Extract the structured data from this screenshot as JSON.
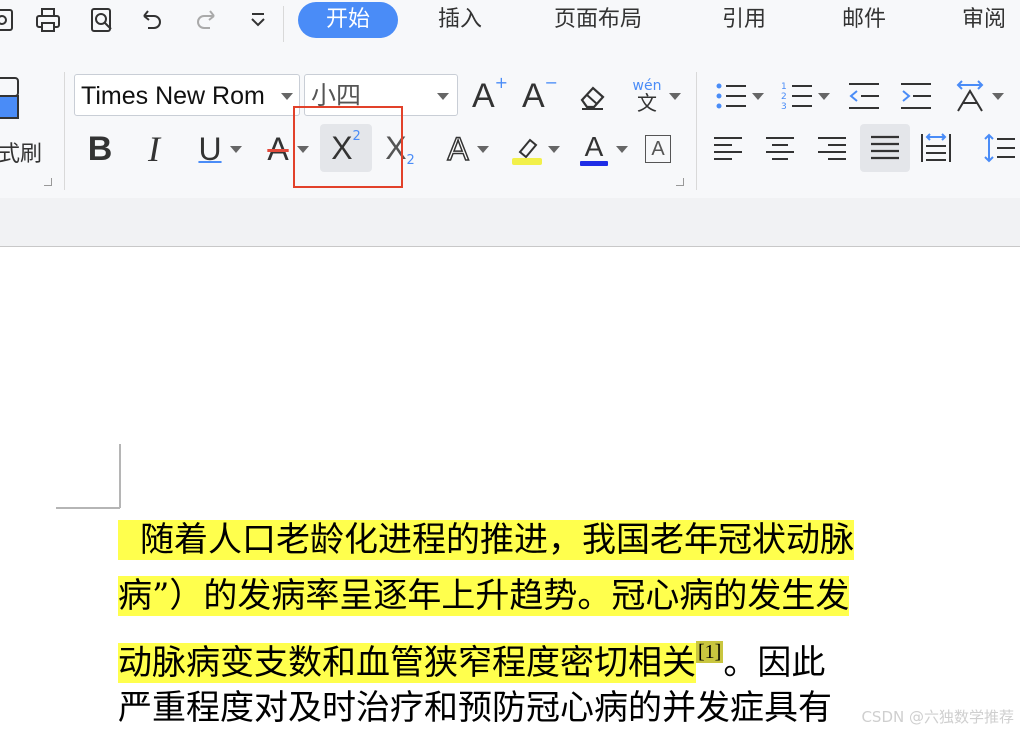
{
  "quick_access": {
    "icons": [
      "save-icon",
      "print-icon",
      "print-preview-icon",
      "undo-icon",
      "redo-icon",
      "more-dropdown-icon"
    ]
  },
  "tabs": [
    {
      "label": "开始",
      "active": true
    },
    {
      "label": "插入"
    },
    {
      "label": "页面布局"
    },
    {
      "label": "引用"
    },
    {
      "label": "邮件"
    },
    {
      "label": "审阅"
    }
  ],
  "clipboard": {
    "format_painter_label": "式刷"
  },
  "font": {
    "family_value": "Times New Rom",
    "size_value": "小四",
    "phonetic_label": "wén",
    "phonetic_char": "文"
  },
  "format_buttons": {
    "bold": "B",
    "italic": "I",
    "underline": "U",
    "strike": "A",
    "superscript": "X",
    "superscript_mark": "2",
    "subscript": "X",
    "subscript_mark": "2",
    "text_effect": "A",
    "font_color": "A",
    "char_border": "A",
    "grow": "A",
    "grow_mark": "+",
    "shrink": "A",
    "shrink_mark": "−"
  },
  "colors": {
    "accent": "#4a8cf7",
    "highlight": "#ffff4d",
    "highlight_box": "#e2412a",
    "font_color_bar": "#1f2de6",
    "highlighter_bar": "#f2f04a"
  },
  "document": {
    "lines": [
      {
        "text": "随着人口老龄化进程的推进，我国老年冠状动脉",
        "highlight": true
      },
      {
        "text": "病”）的发病率呈逐年上升趋势。冠心病的发生发",
        "highlight": true
      },
      {
        "text": "动脉病变支数和血管狭窄程度密切相关",
        "highlight": true,
        "citation": "[1]",
        "after": "。因此"
      },
      {
        "text": "严重程度对及时治疗和预防冠心病的并发症具有",
        "highlight": false
      }
    ]
  },
  "watermark": "CSDN @六独数学推荐"
}
